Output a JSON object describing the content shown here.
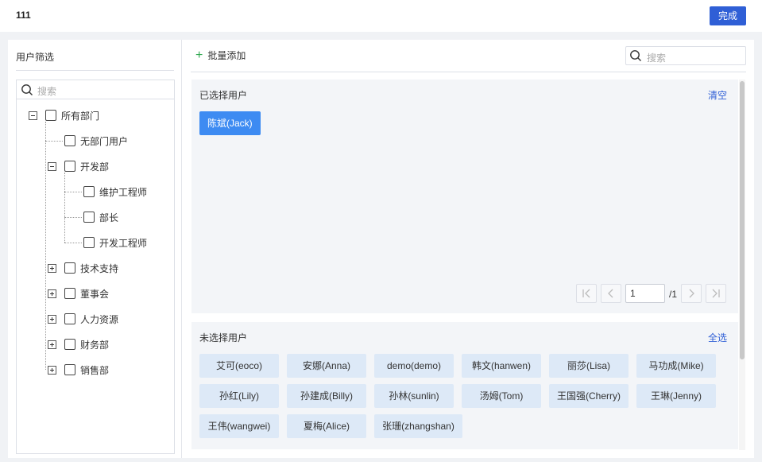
{
  "header": {
    "title": "111",
    "done_label": "完成"
  },
  "left": {
    "title": "用户筛选",
    "search_placeholder": "搜索",
    "tree": {
      "root": "所有部门",
      "no_dept": "无部门用户",
      "dev": "开发部",
      "dev_children": [
        "维护工程师",
        "部长",
        "开发工程师"
      ],
      "tech": "技术支持",
      "board": "董事会",
      "hr": "人力资源",
      "finance": "财务部",
      "sales": "销售部"
    }
  },
  "right": {
    "batch_add_label": "批量添加",
    "search_placeholder": "搜索",
    "selected": {
      "title": "已选择用户",
      "clear_label": "清空",
      "users": [
        "陈斌(Jack)"
      ],
      "pager": {
        "page": "1",
        "total": "/1"
      }
    },
    "unselected": {
      "title": "未选择用户",
      "select_all_label": "全选",
      "users": [
        "艾可(eoco)",
        "安娜(Anna)",
        "demo(demo)",
        "韩文(hanwen)",
        "丽莎(Lisa)",
        "马功成(Mike)",
        "孙红(Lily)",
        "孙建成(Billy)",
        "孙林(sunlin)",
        "汤姆(Tom)",
        "王国强(Cherry)",
        "王琳(Jenny)",
        "王伟(wangwei)",
        "夏梅(Alice)",
        "张珊(zhangshan)"
      ]
    }
  },
  "colors": {
    "primary": "#2f5fd6",
    "selected_chip": "#3d8bf2",
    "chip_bg": "#dde9f7",
    "add_icon": "#2fa84f"
  }
}
